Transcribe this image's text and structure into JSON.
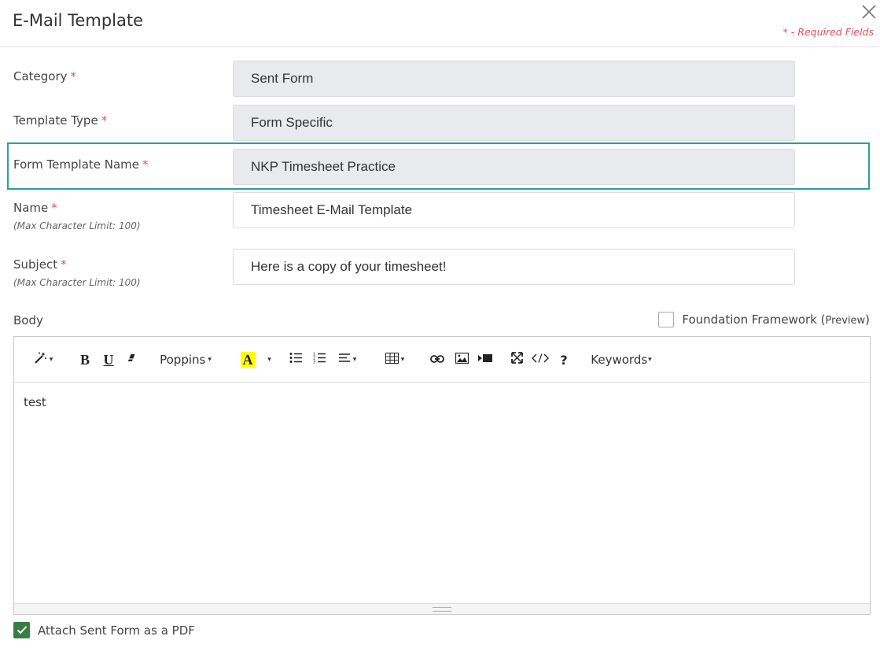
{
  "dialog": {
    "title": "E-Mail Template",
    "required_note": "* - Required Fields"
  },
  "fields": {
    "category": {
      "label": "Category",
      "value": "Sent Form"
    },
    "template_type": {
      "label": "Template Type",
      "value": "Form Specific"
    },
    "form_template_name": {
      "label": "Form Template Name",
      "value": "NKP Timesheet Practice"
    },
    "name": {
      "label": "Name",
      "hint": "(Max Character Limit: 100)",
      "value": "Timesheet E-Mail Template"
    },
    "subject": {
      "label": "Subject",
      "hint": "(Max Character Limit: 100)",
      "value": "Here is a copy of your timesheet!"
    }
  },
  "required_marker": "*",
  "body": {
    "label": "Body",
    "foundation_label": "Foundation Framework (",
    "foundation_preview": "Preview",
    "foundation_close": ")",
    "content": "test"
  },
  "toolbar": {
    "bold": "B",
    "underline": "U",
    "font": "Poppins",
    "color_letter": "A",
    "help": "?",
    "keywords": "Keywords",
    "caret": "▾"
  },
  "attach": {
    "label": "Attach Sent Form as a PDF",
    "checked": true
  },
  "colors": {
    "required": "#e0505a",
    "highlight": "#2a9d9c",
    "checkbox": "#3a7d44",
    "readonly_bg": "#e8eaed"
  }
}
